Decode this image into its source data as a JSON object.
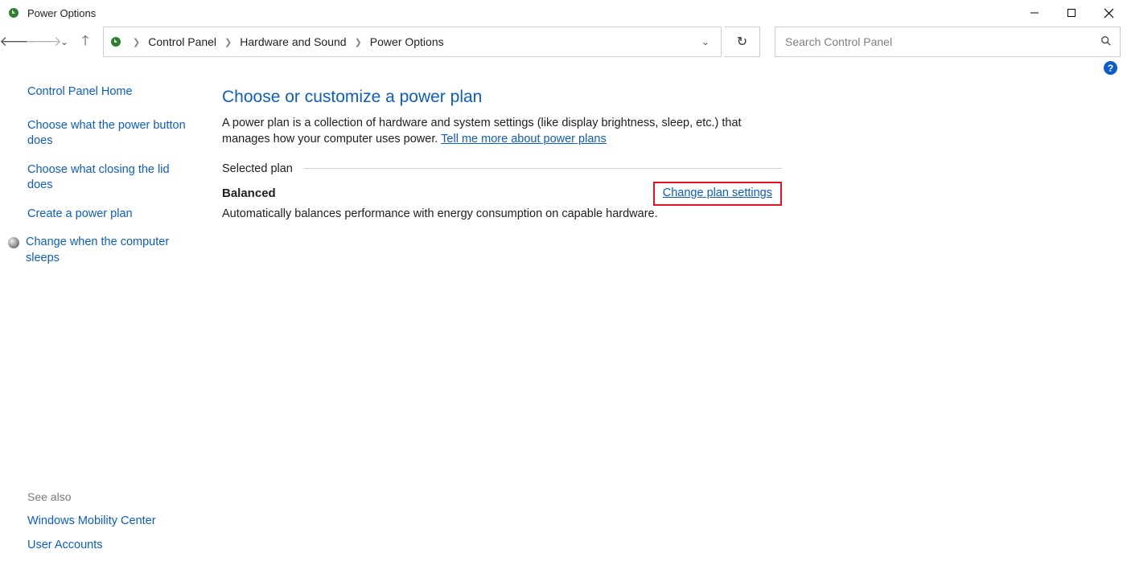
{
  "window": {
    "title": "Power Options"
  },
  "breadcrumb": {
    "items": [
      "Control Panel",
      "Hardware and Sound",
      "Power Options"
    ]
  },
  "search": {
    "placeholder": "Search Control Panel"
  },
  "sidebar": {
    "home": "Control Panel Home",
    "links": [
      "Choose what the power button does",
      "Choose what closing the lid does",
      "Create a power plan"
    ],
    "bullet_link": "Change when the computer sleeps",
    "see_also_label": "See also",
    "see_also": [
      "Windows Mobility Center",
      "User Accounts"
    ]
  },
  "main": {
    "heading": "Choose or customize a power plan",
    "description_prefix": "A power plan is a collection of hardware and system settings (like display brightness, sleep, etc.) that manages how your computer uses power. ",
    "description_link": "Tell me more about power plans",
    "selected_plan_label": "Selected plan",
    "plan": {
      "name": "Balanced",
      "change_link": "Change plan settings",
      "description": "Automatically balances performance with energy consumption on capable hardware."
    }
  }
}
